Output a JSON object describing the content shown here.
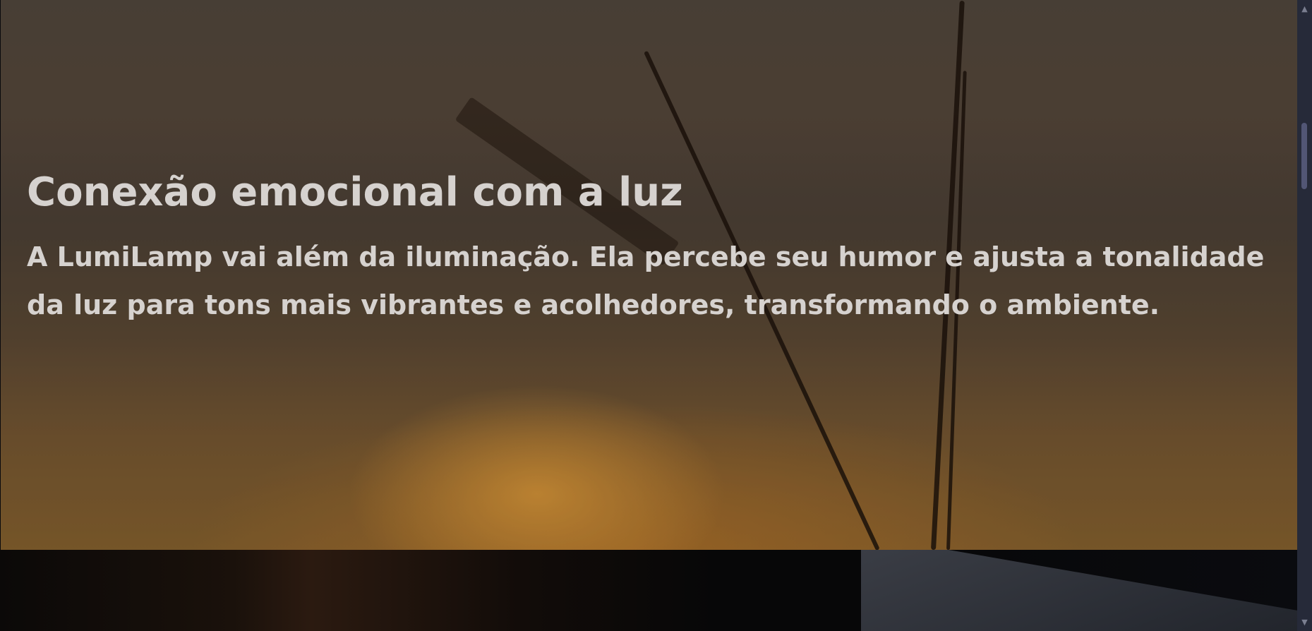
{
  "hero": {
    "title": "Conexão emocional com a luz",
    "description": "A LumiLamp vai além da iluminação. Ela percebe seu humor e ajusta a tonalidade da luz para tons mais vibrantes e acolhedores, transformando o ambiente."
  },
  "scrollbar": {
    "up_icon": "chevron-up-icon",
    "down_icon": "chevron-down-icon"
  }
}
